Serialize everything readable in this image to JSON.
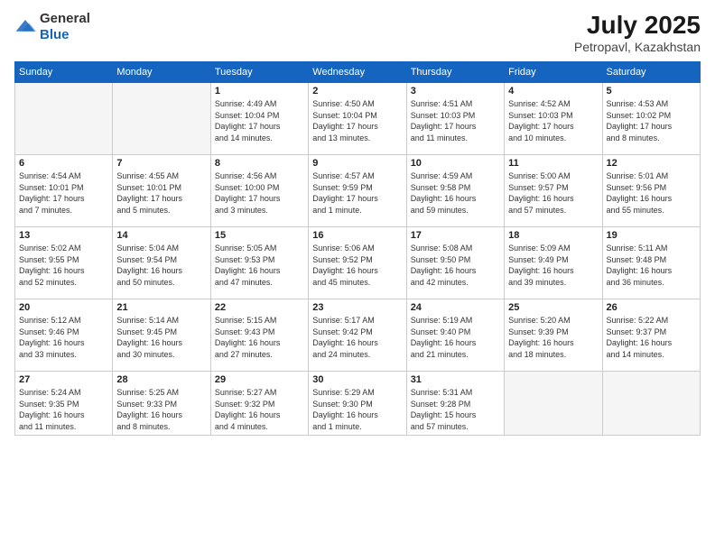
{
  "header": {
    "logo_general": "General",
    "logo_blue": "Blue",
    "month_year": "July 2025",
    "location": "Petropavl, Kazakhstan"
  },
  "weekdays": [
    "Sunday",
    "Monday",
    "Tuesday",
    "Wednesday",
    "Thursday",
    "Friday",
    "Saturday"
  ],
  "weeks": [
    [
      {
        "day": "",
        "info": ""
      },
      {
        "day": "",
        "info": ""
      },
      {
        "day": "1",
        "info": "Sunrise: 4:49 AM\nSunset: 10:04 PM\nDaylight: 17 hours\nand 14 minutes."
      },
      {
        "day": "2",
        "info": "Sunrise: 4:50 AM\nSunset: 10:04 PM\nDaylight: 17 hours\nand 13 minutes."
      },
      {
        "day": "3",
        "info": "Sunrise: 4:51 AM\nSunset: 10:03 PM\nDaylight: 17 hours\nand 11 minutes."
      },
      {
        "day": "4",
        "info": "Sunrise: 4:52 AM\nSunset: 10:03 PM\nDaylight: 17 hours\nand 10 minutes."
      },
      {
        "day": "5",
        "info": "Sunrise: 4:53 AM\nSunset: 10:02 PM\nDaylight: 17 hours\nand 8 minutes."
      }
    ],
    [
      {
        "day": "6",
        "info": "Sunrise: 4:54 AM\nSunset: 10:01 PM\nDaylight: 17 hours\nand 7 minutes."
      },
      {
        "day": "7",
        "info": "Sunrise: 4:55 AM\nSunset: 10:01 PM\nDaylight: 17 hours\nand 5 minutes."
      },
      {
        "day": "8",
        "info": "Sunrise: 4:56 AM\nSunset: 10:00 PM\nDaylight: 17 hours\nand 3 minutes."
      },
      {
        "day": "9",
        "info": "Sunrise: 4:57 AM\nSunset: 9:59 PM\nDaylight: 17 hours\nand 1 minute."
      },
      {
        "day": "10",
        "info": "Sunrise: 4:59 AM\nSunset: 9:58 PM\nDaylight: 16 hours\nand 59 minutes."
      },
      {
        "day": "11",
        "info": "Sunrise: 5:00 AM\nSunset: 9:57 PM\nDaylight: 16 hours\nand 57 minutes."
      },
      {
        "day": "12",
        "info": "Sunrise: 5:01 AM\nSunset: 9:56 PM\nDaylight: 16 hours\nand 55 minutes."
      }
    ],
    [
      {
        "day": "13",
        "info": "Sunrise: 5:02 AM\nSunset: 9:55 PM\nDaylight: 16 hours\nand 52 minutes."
      },
      {
        "day": "14",
        "info": "Sunrise: 5:04 AM\nSunset: 9:54 PM\nDaylight: 16 hours\nand 50 minutes."
      },
      {
        "day": "15",
        "info": "Sunrise: 5:05 AM\nSunset: 9:53 PM\nDaylight: 16 hours\nand 47 minutes."
      },
      {
        "day": "16",
        "info": "Sunrise: 5:06 AM\nSunset: 9:52 PM\nDaylight: 16 hours\nand 45 minutes."
      },
      {
        "day": "17",
        "info": "Sunrise: 5:08 AM\nSunset: 9:50 PM\nDaylight: 16 hours\nand 42 minutes."
      },
      {
        "day": "18",
        "info": "Sunrise: 5:09 AM\nSunset: 9:49 PM\nDaylight: 16 hours\nand 39 minutes."
      },
      {
        "day": "19",
        "info": "Sunrise: 5:11 AM\nSunset: 9:48 PM\nDaylight: 16 hours\nand 36 minutes."
      }
    ],
    [
      {
        "day": "20",
        "info": "Sunrise: 5:12 AM\nSunset: 9:46 PM\nDaylight: 16 hours\nand 33 minutes."
      },
      {
        "day": "21",
        "info": "Sunrise: 5:14 AM\nSunset: 9:45 PM\nDaylight: 16 hours\nand 30 minutes."
      },
      {
        "day": "22",
        "info": "Sunrise: 5:15 AM\nSunset: 9:43 PM\nDaylight: 16 hours\nand 27 minutes."
      },
      {
        "day": "23",
        "info": "Sunrise: 5:17 AM\nSunset: 9:42 PM\nDaylight: 16 hours\nand 24 minutes."
      },
      {
        "day": "24",
        "info": "Sunrise: 5:19 AM\nSunset: 9:40 PM\nDaylight: 16 hours\nand 21 minutes."
      },
      {
        "day": "25",
        "info": "Sunrise: 5:20 AM\nSunset: 9:39 PM\nDaylight: 16 hours\nand 18 minutes."
      },
      {
        "day": "26",
        "info": "Sunrise: 5:22 AM\nSunset: 9:37 PM\nDaylight: 16 hours\nand 14 minutes."
      }
    ],
    [
      {
        "day": "27",
        "info": "Sunrise: 5:24 AM\nSunset: 9:35 PM\nDaylight: 16 hours\nand 11 minutes."
      },
      {
        "day": "28",
        "info": "Sunrise: 5:25 AM\nSunset: 9:33 PM\nDaylight: 16 hours\nand 8 minutes."
      },
      {
        "day": "29",
        "info": "Sunrise: 5:27 AM\nSunset: 9:32 PM\nDaylight: 16 hours\nand 4 minutes."
      },
      {
        "day": "30",
        "info": "Sunrise: 5:29 AM\nSunset: 9:30 PM\nDaylight: 16 hours\nand 1 minute."
      },
      {
        "day": "31",
        "info": "Sunrise: 5:31 AM\nSunset: 9:28 PM\nDaylight: 15 hours\nand 57 minutes."
      },
      {
        "day": "",
        "info": ""
      },
      {
        "day": "",
        "info": ""
      }
    ]
  ]
}
